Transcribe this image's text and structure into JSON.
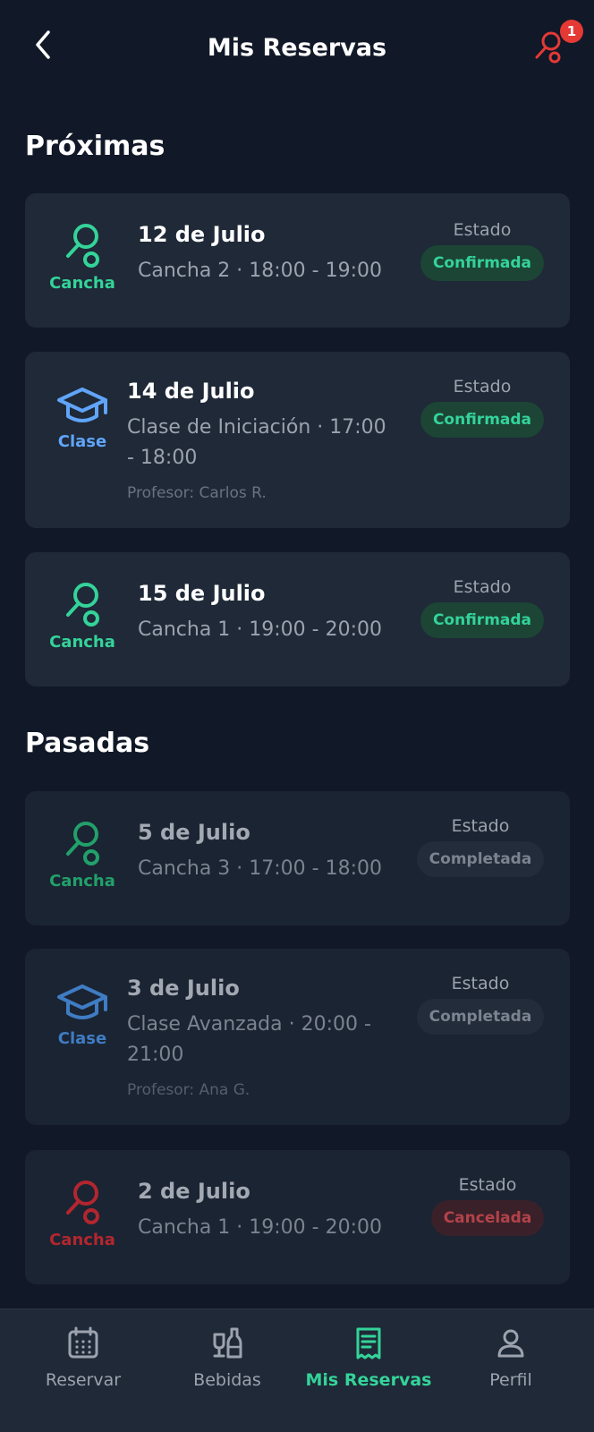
{
  "header": {
    "title": "Mis Reservas",
    "notification_count": "1"
  },
  "sections": {
    "upcoming": "Próximas",
    "past": "Pasadas"
  },
  "status_label": "Estado",
  "upcoming": [
    {
      "type": "Cancha",
      "date": "12 de Julio",
      "detail": "Cancha 2 · 18:00 - 19:00",
      "status": "Confirmada"
    },
    {
      "type": "Clase",
      "date": "14 de Julio",
      "detail_line1": "Clase de Iniciación · 17:00",
      "detail_line2": "- 18:00",
      "teacher": "Profesor: Carlos R.",
      "status": "Confirmada"
    },
    {
      "type": "Cancha",
      "date": "15 de Julio",
      "detail": "Cancha 1 · 19:00 - 20:00",
      "status": "Confirmada"
    }
  ],
  "past": [
    {
      "type": "Cancha",
      "date": "5 de Julio",
      "detail": "Cancha 3 · 17:00 - 18:00",
      "status": "Completada"
    },
    {
      "type": "Clase",
      "date": "3 de Julio",
      "detail_line1": "Clase Avanzada · 20:00 -",
      "detail_line2": "21:00",
      "teacher": "Profesor: Ana G.",
      "status": "Completada"
    },
    {
      "type": "Cancha",
      "date": "2 de Julio",
      "detail": "Cancha 1 · 19:00 - 20:00",
      "status": "Cancelada"
    }
  ],
  "nav": [
    {
      "label": "Reservar",
      "icon": "calendar-icon"
    },
    {
      "label": "Bebidas",
      "icon": "drinks-icon"
    },
    {
      "label": "Mis Reservas",
      "icon": "receipt-icon",
      "active": true
    },
    {
      "label": "Perfil",
      "icon": "user-icon"
    }
  ],
  "colors": {
    "background": "#111827",
    "card": "#1f2937",
    "accent_green": "#34d399",
    "accent_blue": "#60a5fa",
    "cancel_red": "#b3262f",
    "notif_red": "#e53935"
  }
}
